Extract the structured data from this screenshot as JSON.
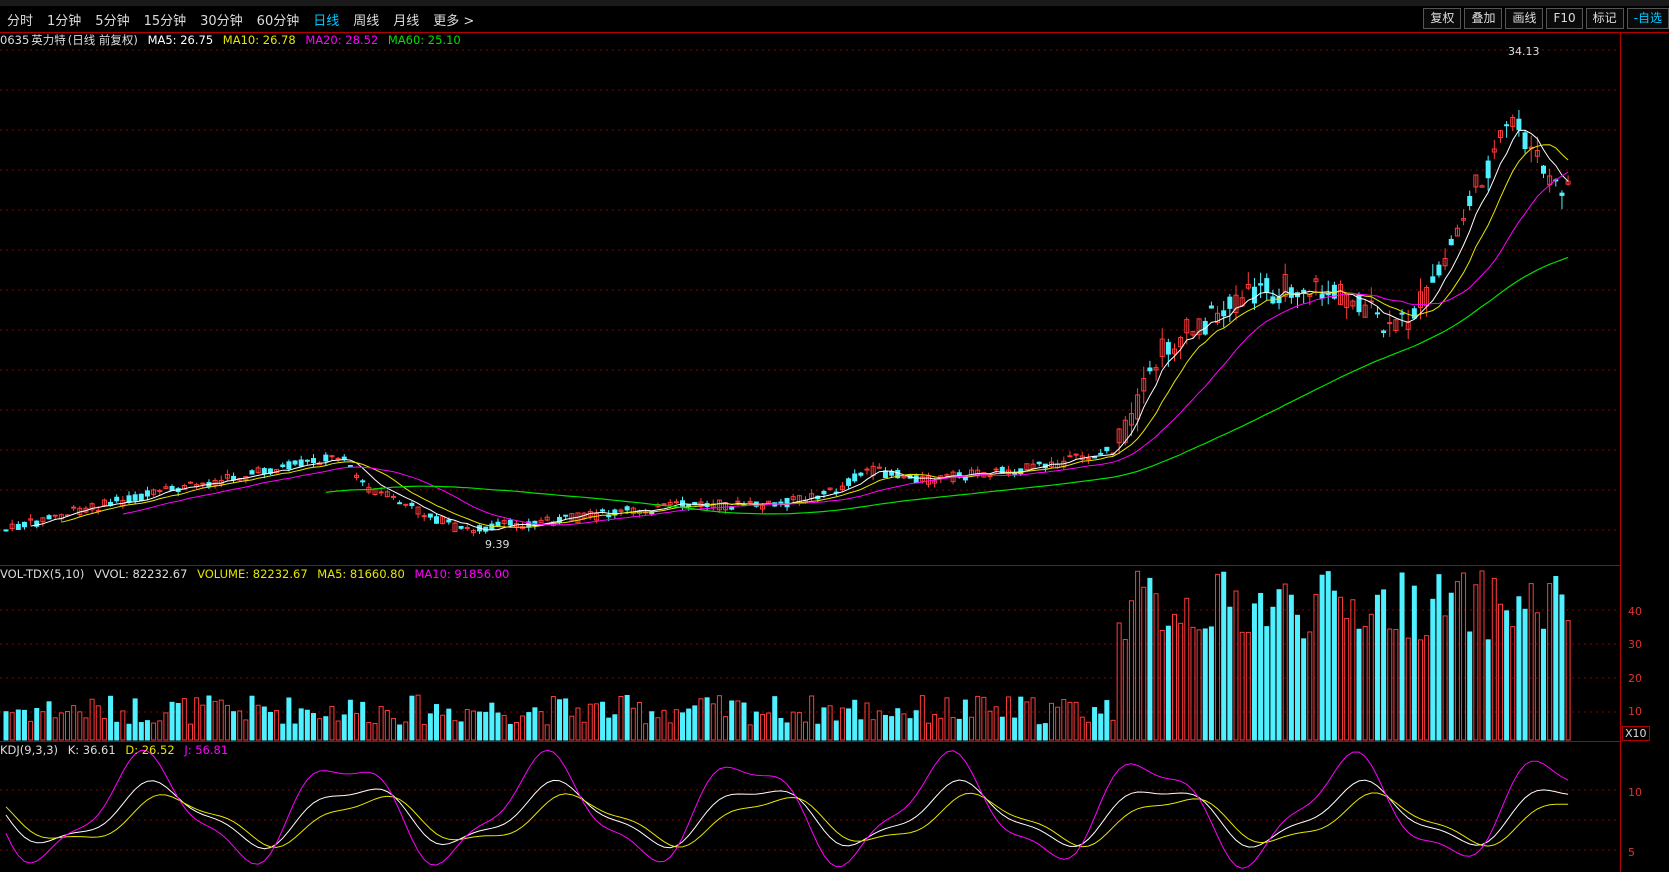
{
  "toolbar": {
    "tabs": [
      "分时",
      "1分钟",
      "5分钟",
      "15分钟",
      "30分钟",
      "60分钟",
      "日线",
      "周线",
      "月线",
      "更多 >"
    ],
    "active_tab": "日线",
    "right_buttons": [
      "复权",
      "叠加",
      "画线",
      "F10",
      "标记",
      "-自选"
    ]
  },
  "price_panel": {
    "stock_code_fragment": "0635",
    "stock_name": "英力特",
    "mode": "(日线 前复权)",
    "ma5": "MA5: 26.75",
    "ma10": "MA10: 26.78",
    "ma20": "MA20: 28.52",
    "ma60": "MA60: 25.10",
    "high_label": "34.13",
    "low_label": "9.39"
  },
  "volume_panel": {
    "title": "VOL-TDX(5,10)",
    "vvol": "VVOL: 82232.67",
    "volume": "VOLUME: 82232.67",
    "ma5": "MA5: 81660.80",
    "ma10": "MA10: 91856.00",
    "axis_labels": [
      "40",
      "30",
      "20",
      "10"
    ],
    "unit": "X10"
  },
  "kdj_panel": {
    "title": "KDJ(9,3,3)",
    "k": "K: 36.61",
    "d": "D: 26.52",
    "j": "J: 56.81",
    "axis_labels": [
      "10",
      "5"
    ]
  },
  "colors": {
    "up": "#ff3b3b",
    "down": "#4ff0ff",
    "ma5": "#ffffff",
    "ma10": "#e6e600",
    "ma20": "#ff00ff",
    "ma60": "#00e000",
    "grid": "#8a0000"
  }
}
